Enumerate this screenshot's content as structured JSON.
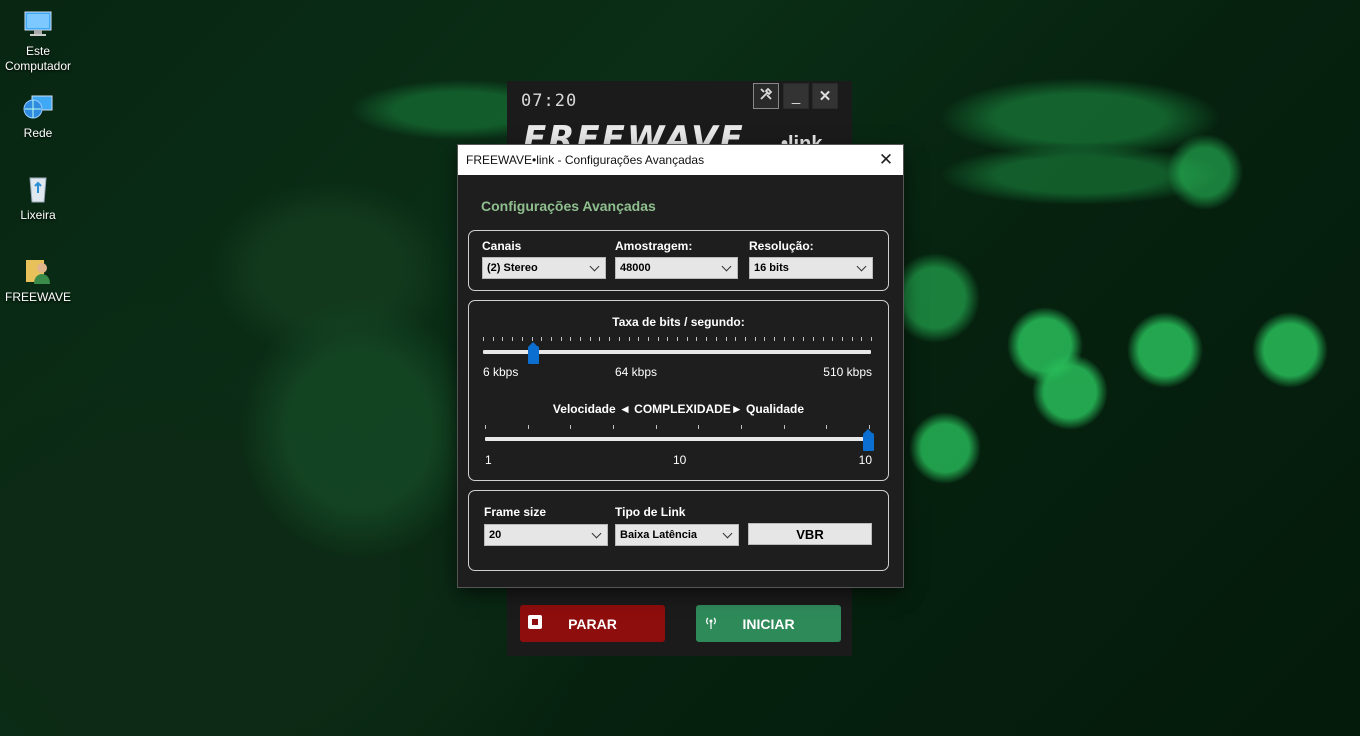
{
  "desktop": {
    "icons": [
      {
        "label": "Este Computador",
        "icon": "computer-icon"
      },
      {
        "label": "Rede",
        "icon": "network-icon"
      },
      {
        "label": "Lixeira",
        "icon": "recycle-bin-icon"
      },
      {
        "label": "FREEWAVE",
        "icon": "user-folder-icon"
      }
    ]
  },
  "app": {
    "clock": "07:20",
    "logo": "FREEWAVE",
    "logo_suffix": "•link",
    "tools_icon": "tools-icon",
    "minimize_label": "_",
    "close_label": "✕",
    "stop_label": "PARAR",
    "start_label": "INICIAR",
    "colors": {
      "stop": "#8e0d0d",
      "start": "#2f8a5a"
    }
  },
  "dialog": {
    "title": "FREEWAVE•link - Configurações Avançadas",
    "heading": "Configurações Avançadas",
    "close_label": "✕",
    "audio": {
      "channels": {
        "label": "Canais",
        "value": "(2) Stereo"
      },
      "sampling": {
        "label": "Amostragem:",
        "value": "48000"
      },
      "resolution": {
        "label": "Resolução:",
        "value": "16 bits"
      }
    },
    "bitrate": {
      "label": "Taxa de bits / segundo:",
      "min": "6 kbps",
      "mid": "64 kbps",
      "max": "510 kbps",
      "position": 0.128
    },
    "complexity": {
      "label": "Velocidade ◄ COMPLEXIDADE► Qualidade",
      "min": "1",
      "mid": "10",
      "max": "10",
      "value": 10
    },
    "frame": {
      "frame_size": {
        "label": "Frame size",
        "value": "20"
      },
      "link_type": {
        "label": "Tipo de Link",
        "value": "Baixa Latência"
      },
      "mode_button": "VBR"
    }
  }
}
